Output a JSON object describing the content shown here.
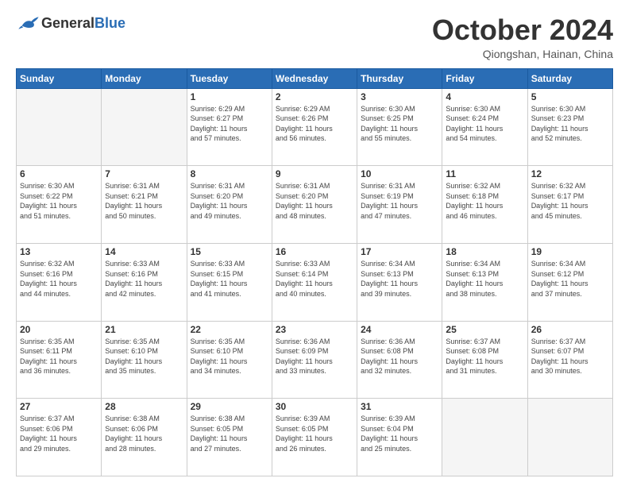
{
  "header": {
    "logo_general": "General",
    "logo_blue": "Blue",
    "month_title": "October 2024",
    "location": "Qiongshan, Hainan, China"
  },
  "weekdays": [
    "Sunday",
    "Monday",
    "Tuesday",
    "Wednesday",
    "Thursday",
    "Friday",
    "Saturday"
  ],
  "weeks": [
    [
      {
        "day": "",
        "info": ""
      },
      {
        "day": "",
        "info": ""
      },
      {
        "day": "1",
        "info": "Sunrise: 6:29 AM\nSunset: 6:27 PM\nDaylight: 11 hours\nand 57 minutes."
      },
      {
        "day": "2",
        "info": "Sunrise: 6:29 AM\nSunset: 6:26 PM\nDaylight: 11 hours\nand 56 minutes."
      },
      {
        "day": "3",
        "info": "Sunrise: 6:30 AM\nSunset: 6:25 PM\nDaylight: 11 hours\nand 55 minutes."
      },
      {
        "day": "4",
        "info": "Sunrise: 6:30 AM\nSunset: 6:24 PM\nDaylight: 11 hours\nand 54 minutes."
      },
      {
        "day": "5",
        "info": "Sunrise: 6:30 AM\nSunset: 6:23 PM\nDaylight: 11 hours\nand 52 minutes."
      }
    ],
    [
      {
        "day": "6",
        "info": "Sunrise: 6:30 AM\nSunset: 6:22 PM\nDaylight: 11 hours\nand 51 minutes."
      },
      {
        "day": "7",
        "info": "Sunrise: 6:31 AM\nSunset: 6:21 PM\nDaylight: 11 hours\nand 50 minutes."
      },
      {
        "day": "8",
        "info": "Sunrise: 6:31 AM\nSunset: 6:20 PM\nDaylight: 11 hours\nand 49 minutes."
      },
      {
        "day": "9",
        "info": "Sunrise: 6:31 AM\nSunset: 6:20 PM\nDaylight: 11 hours\nand 48 minutes."
      },
      {
        "day": "10",
        "info": "Sunrise: 6:31 AM\nSunset: 6:19 PM\nDaylight: 11 hours\nand 47 minutes."
      },
      {
        "day": "11",
        "info": "Sunrise: 6:32 AM\nSunset: 6:18 PM\nDaylight: 11 hours\nand 46 minutes."
      },
      {
        "day": "12",
        "info": "Sunrise: 6:32 AM\nSunset: 6:17 PM\nDaylight: 11 hours\nand 45 minutes."
      }
    ],
    [
      {
        "day": "13",
        "info": "Sunrise: 6:32 AM\nSunset: 6:16 PM\nDaylight: 11 hours\nand 44 minutes."
      },
      {
        "day": "14",
        "info": "Sunrise: 6:33 AM\nSunset: 6:16 PM\nDaylight: 11 hours\nand 42 minutes."
      },
      {
        "day": "15",
        "info": "Sunrise: 6:33 AM\nSunset: 6:15 PM\nDaylight: 11 hours\nand 41 minutes."
      },
      {
        "day": "16",
        "info": "Sunrise: 6:33 AM\nSunset: 6:14 PM\nDaylight: 11 hours\nand 40 minutes."
      },
      {
        "day": "17",
        "info": "Sunrise: 6:34 AM\nSunset: 6:13 PM\nDaylight: 11 hours\nand 39 minutes."
      },
      {
        "day": "18",
        "info": "Sunrise: 6:34 AM\nSunset: 6:13 PM\nDaylight: 11 hours\nand 38 minutes."
      },
      {
        "day": "19",
        "info": "Sunrise: 6:34 AM\nSunset: 6:12 PM\nDaylight: 11 hours\nand 37 minutes."
      }
    ],
    [
      {
        "day": "20",
        "info": "Sunrise: 6:35 AM\nSunset: 6:11 PM\nDaylight: 11 hours\nand 36 minutes."
      },
      {
        "day": "21",
        "info": "Sunrise: 6:35 AM\nSunset: 6:10 PM\nDaylight: 11 hours\nand 35 minutes."
      },
      {
        "day": "22",
        "info": "Sunrise: 6:35 AM\nSunset: 6:10 PM\nDaylight: 11 hours\nand 34 minutes."
      },
      {
        "day": "23",
        "info": "Sunrise: 6:36 AM\nSunset: 6:09 PM\nDaylight: 11 hours\nand 33 minutes."
      },
      {
        "day": "24",
        "info": "Sunrise: 6:36 AM\nSunset: 6:08 PM\nDaylight: 11 hours\nand 32 minutes."
      },
      {
        "day": "25",
        "info": "Sunrise: 6:37 AM\nSunset: 6:08 PM\nDaylight: 11 hours\nand 31 minutes."
      },
      {
        "day": "26",
        "info": "Sunrise: 6:37 AM\nSunset: 6:07 PM\nDaylight: 11 hours\nand 30 minutes."
      }
    ],
    [
      {
        "day": "27",
        "info": "Sunrise: 6:37 AM\nSunset: 6:06 PM\nDaylight: 11 hours\nand 29 minutes."
      },
      {
        "day": "28",
        "info": "Sunrise: 6:38 AM\nSunset: 6:06 PM\nDaylight: 11 hours\nand 28 minutes."
      },
      {
        "day": "29",
        "info": "Sunrise: 6:38 AM\nSunset: 6:05 PM\nDaylight: 11 hours\nand 27 minutes."
      },
      {
        "day": "30",
        "info": "Sunrise: 6:39 AM\nSunset: 6:05 PM\nDaylight: 11 hours\nand 26 minutes."
      },
      {
        "day": "31",
        "info": "Sunrise: 6:39 AM\nSunset: 6:04 PM\nDaylight: 11 hours\nand 25 minutes."
      },
      {
        "day": "",
        "info": ""
      },
      {
        "day": "",
        "info": ""
      }
    ]
  ]
}
